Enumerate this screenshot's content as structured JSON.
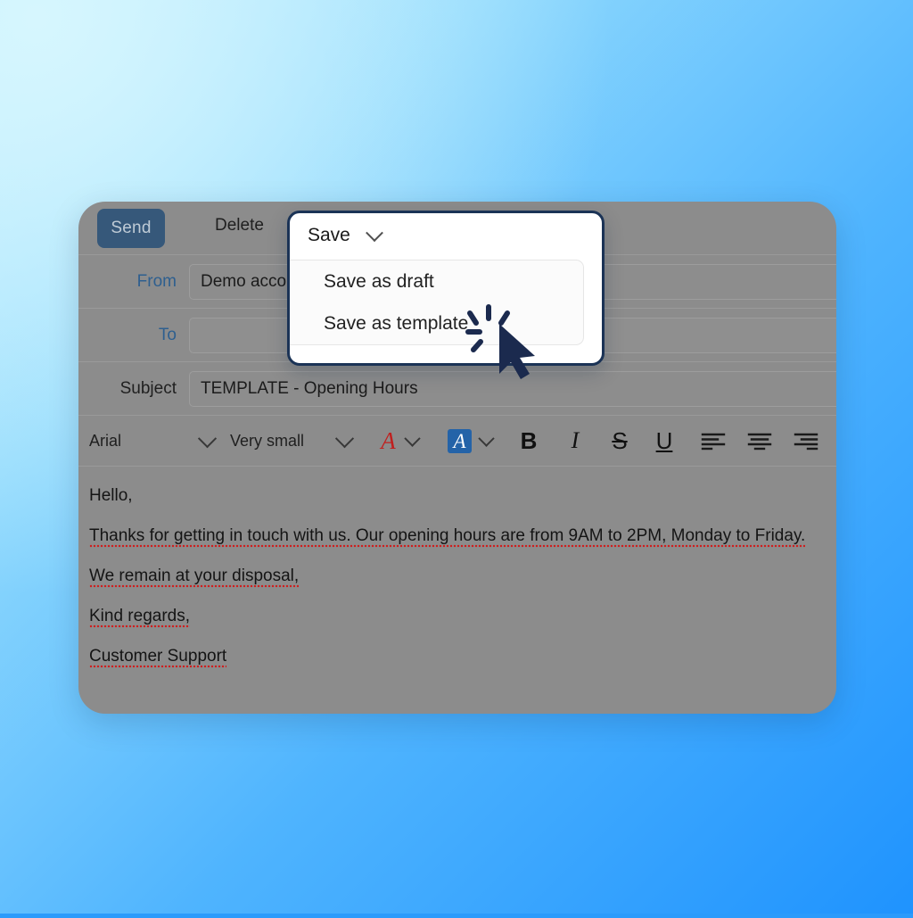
{
  "window": {
    "app": "email-compose",
    "card_bg": "#8c8c8c"
  },
  "action_bar": {
    "send_label": "Send",
    "delete_label": "Delete"
  },
  "fields": [
    {
      "label": "From",
      "value": "Demo account",
      "label_color": "#2e5f8f",
      "empty": false
    },
    {
      "label": "To",
      "value": "",
      "label_color": "#2e5f8f",
      "empty": true
    },
    {
      "label": "Subject",
      "value": "TEMPLATE - Opening Hours",
      "label_color": "#1f1f1f",
      "empty": false
    }
  ],
  "toolbar": {
    "font_family": "Arial",
    "font_size": "Very small",
    "font_color_glyph": "A",
    "highlight_glyph": "A",
    "bold_glyph": "B",
    "italic_glyph": "I",
    "strikethrough_glyph": "S",
    "underline_glyph": "U",
    "font_color_hex": "#c0201f",
    "highlight_hex": "#2463a8"
  },
  "body": {
    "lines": [
      "Hello,",
      "Thanks for getting in touch with us. Our opening hours are from 9AM to 2PM, Monday to Friday.",
      "We remain at your disposal,",
      "Kind regards,",
      "Customer Support"
    ]
  },
  "save_dropdown": {
    "trigger_label": "Save",
    "items": [
      {
        "label": "Save as draft"
      },
      {
        "label": "Save as template"
      }
    ],
    "border_color": "#1b3356"
  },
  "cursor": {
    "state": "click",
    "color": "#1b2a4e"
  },
  "background": {
    "from": "#bfeefc",
    "to": "#1f93fe"
  }
}
